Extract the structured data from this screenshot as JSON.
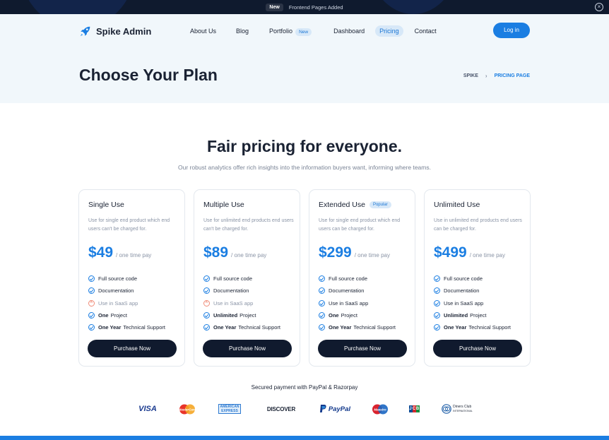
{
  "topbar": {
    "badge": "New",
    "announcement": "Frontend Pages Added"
  },
  "nav": {
    "brand": "Spike Admin",
    "items": [
      {
        "label": "About Us"
      },
      {
        "label": "Blog"
      },
      {
        "label": "Portfolio",
        "badge": "New"
      },
      {
        "label": "Dashboard"
      },
      {
        "label": "Pricing",
        "active": true
      },
      {
        "label": "Contact"
      }
    ],
    "login_label": "Log in"
  },
  "header": {
    "title": "Choose Your Plan",
    "breadcrumb": [
      "SPIKE",
      "PRICING PAGE"
    ]
  },
  "pricing": {
    "heading": "Fair pricing for everyone.",
    "subheading": "Our robust analytics offer rich insights into the information buyers want, informing where teams.",
    "plans": [
      {
        "name": "Single Use",
        "badge": "",
        "description": "Use for single end product which end users can't be charged for.",
        "price": "$49",
        "price_note": "/ one time pay",
        "features": [
          {
            "strong": "",
            "text": "Full source code",
            "included": true
          },
          {
            "strong": "",
            "text": "Documentation",
            "included": true
          },
          {
            "strong": "",
            "text": "Use in SaaS app",
            "included": false
          },
          {
            "strong": "One",
            "text": "Project",
            "included": true
          },
          {
            "strong": "One Year",
            "text": "Technical Support",
            "included": true
          }
        ],
        "button": "Purchase Now"
      },
      {
        "name": "Multiple Use",
        "badge": "",
        "description": "Use for unlimited end products end users can't be charged for.",
        "price": "$89",
        "price_note": "/ one time pay",
        "features": [
          {
            "strong": "",
            "text": "Full source code",
            "included": true
          },
          {
            "strong": "",
            "text": "Documentation",
            "included": true
          },
          {
            "strong": "",
            "text": "Use in SaaS app",
            "included": false
          },
          {
            "strong": "Unlimited",
            "text": "Project",
            "included": true
          },
          {
            "strong": "One Year",
            "text": "Technical Support",
            "included": true
          }
        ],
        "button": "Purchase Now"
      },
      {
        "name": "Extended Use",
        "badge": "Popular",
        "description": "Use for single end product which end users can be charged for.",
        "price": "$299",
        "price_note": "/ one time pay",
        "features": [
          {
            "strong": "",
            "text": "Full source code",
            "included": true
          },
          {
            "strong": "",
            "text": "Documentation",
            "included": true
          },
          {
            "strong": "",
            "text": "Use in SaaS app",
            "included": true
          },
          {
            "strong": "One",
            "text": "Project",
            "included": true
          },
          {
            "strong": "One Year",
            "text": "Technical Support",
            "included": true
          }
        ],
        "button": "Purchase Now"
      },
      {
        "name": "Unlimited Use",
        "badge": "",
        "description": "Use in unlimited end products end users can be charged for.",
        "price": "$499",
        "price_note": "/ one time pay",
        "features": [
          {
            "strong": "",
            "text": "Full source code",
            "included": true
          },
          {
            "strong": "",
            "text": "Documentation",
            "included": true
          },
          {
            "strong": "",
            "text": "Use in SaaS app",
            "included": true
          },
          {
            "strong": "Unlimited",
            "text": "Project",
            "included": true
          },
          {
            "strong": "One Year",
            "text": "Technical Support",
            "included": true
          }
        ],
        "button": "Purchase Now"
      }
    ]
  },
  "payments": {
    "label": "Secured payment with PayPal & Razorpay",
    "logos": [
      "VISA",
      "MasterCard",
      "American Express",
      "DISCOVER",
      "PayPal",
      "Maestro",
      "JCB",
      "Diners Club International"
    ]
  },
  "colors": {
    "accent": "#1b7ee2",
    "dark": "#101a2e",
    "hero_bg": "#f1f7fb",
    "excluded": "#f08c78"
  }
}
